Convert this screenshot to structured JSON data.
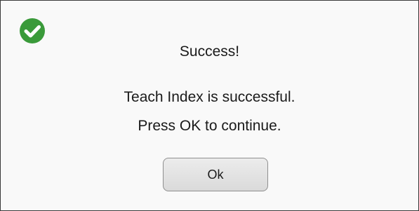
{
  "dialog": {
    "icon": "success-check-icon",
    "icon_color": "#3a9a3a",
    "title": "Success!",
    "message_line1": "Teach Index is successful.",
    "message_line2": "Press OK to continue.",
    "ok_label": "Ok"
  }
}
